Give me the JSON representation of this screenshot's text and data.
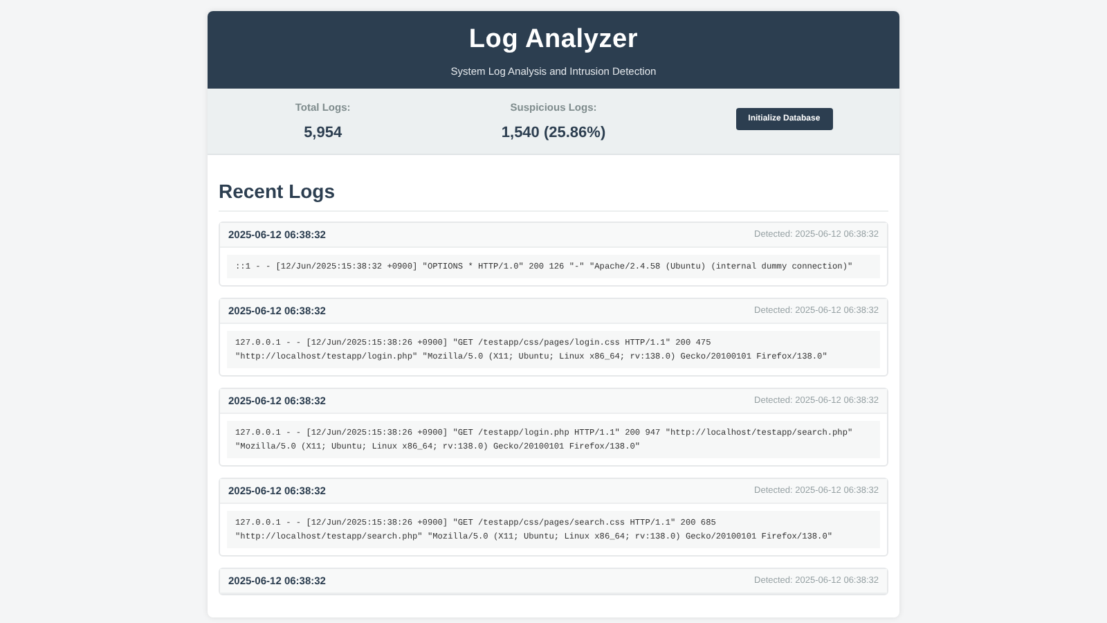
{
  "header": {
    "title": "Log Analyzer",
    "subtitle": "System Log Analysis and Intrusion Detection"
  },
  "stats": [
    {
      "label": "Total Logs:",
      "value": "5,954"
    },
    {
      "label": "Suspicious Logs:",
      "value": "1,540 (25.86%)"
    }
  ],
  "init_button": "Initialize Database",
  "section_title": "Recent Logs",
  "logs": [
    {
      "timestamp": "2025-06-12 06:38:32",
      "detected": "Detected: 2025-06-12 06:38:32",
      "message": "::1 - - [12/Jun/2025:15:38:32 +0900] \"OPTIONS * HTTP/1.0\" 200 126 \"-\" \"Apache/2.4.58 (Ubuntu) (internal dummy connection)\""
    },
    {
      "timestamp": "2025-06-12 06:38:32",
      "detected": "Detected: 2025-06-12 06:38:32",
      "message": "127.0.0.1 - - [12/Jun/2025:15:38:26 +0900] \"GET /testapp/css/pages/login.css HTTP/1.1\" 200 475 \"http://localhost/testapp/login.php\" \"Mozilla/5.0 (X11; Ubuntu; Linux x86_64; rv:138.0) Gecko/20100101 Firefox/138.0\""
    },
    {
      "timestamp": "2025-06-12 06:38:32",
      "detected": "Detected: 2025-06-12 06:38:32",
      "message": "127.0.0.1 - - [12/Jun/2025:15:38:26 +0900] \"GET /testapp/login.php HTTP/1.1\" 200 947 \"http://localhost/testapp/search.php\" \"Mozilla/5.0 (X11; Ubuntu; Linux x86_64; rv:138.0) Gecko/20100101 Firefox/138.0\""
    },
    {
      "timestamp": "2025-06-12 06:38:32",
      "detected": "Detected: 2025-06-12 06:38:32",
      "message": "127.0.0.1 - - [12/Jun/2025:15:38:26 +0900] \"GET /testapp/css/pages/search.css HTTP/1.1\" 200 685 \"http://localhost/testapp/search.php\" \"Mozilla/5.0 (X11; Ubuntu; Linux x86_64; rv:138.0) Gecko/20100101 Firefox/138.0\""
    },
    {
      "timestamp": "2025-06-12 06:38:32",
      "detected": "Detected: 2025-06-12 06:38:32"
    }
  ]
}
